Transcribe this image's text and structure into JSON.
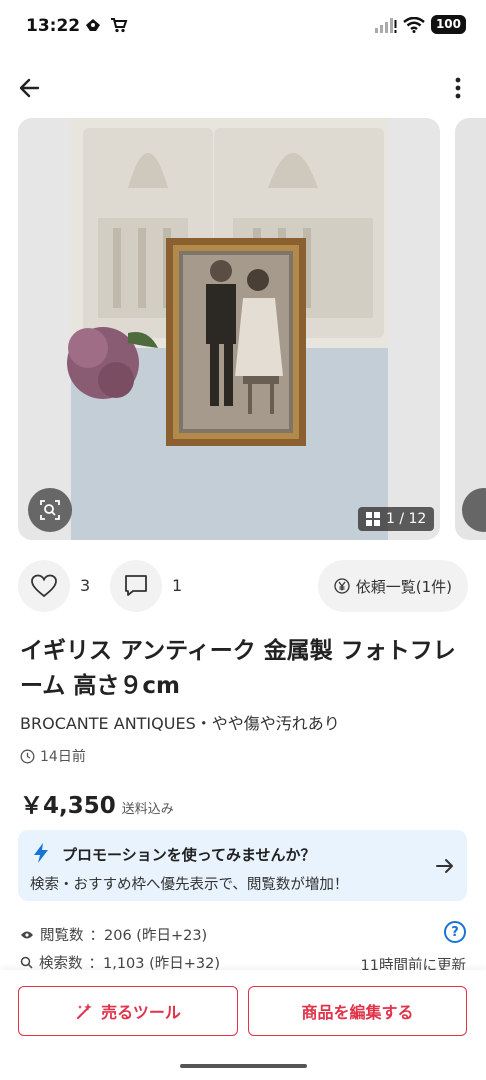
{
  "status_bar": {
    "time": "13:22",
    "battery": "100",
    "icons": [
      "notification-icon",
      "cart-icon",
      "signal-icon",
      "wifi-icon",
      "battery-icon"
    ]
  },
  "nav": {
    "back_icon": "arrow-left-icon",
    "more_icon": "more-vertical-icon"
  },
  "gallery": {
    "counter": "1 / 12",
    "lens_icon": "image-search-icon"
  },
  "engagement": {
    "likes": "3",
    "comments": "1",
    "request_label": "依頼一覧(1件)"
  },
  "item": {
    "title": "イギリス アンティーク 金属製 フォトフレーム 高さ９cm",
    "seller_condition": "BROCANTE ANTIQUES・やや傷や汚れあり",
    "posted": "14日前",
    "price": "￥4,350",
    "price_note": "送料込み"
  },
  "promo": {
    "title": "プロモーションを使ってみませんか？",
    "description": "検索・おすすめ枠へ優先表示で、閲覧数が増加！",
    "color": "#e8f3fd"
  },
  "stats": {
    "views_label": "閲覧数",
    "views_value": "：206 (昨日+23)",
    "search_label": "検索数",
    "search_value": "：1,103 (昨日+32)",
    "updated": "11時間前に更新",
    "help": "?"
  },
  "actions": {
    "sell_tools": "売るツール",
    "edit_item": "商品を編集する",
    "accent": "#e0334a"
  }
}
